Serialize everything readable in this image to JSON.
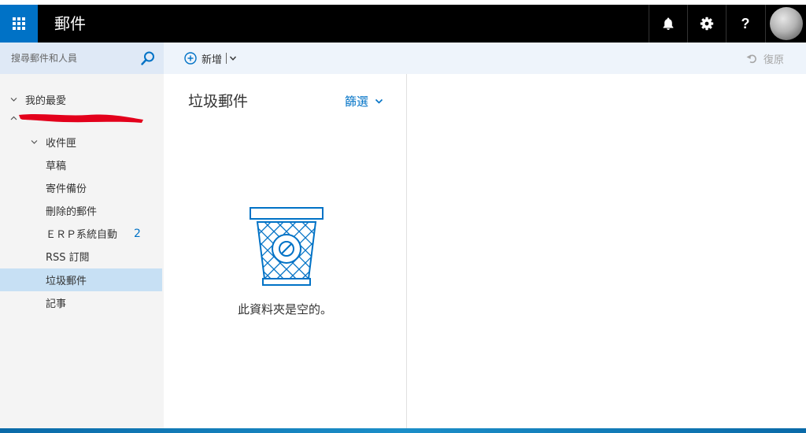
{
  "header": {
    "app_title": "郵件",
    "icons": {
      "launcher": "app-launcher-icon",
      "notifications": "bell-icon",
      "settings": "gear-icon",
      "help": "help-icon",
      "avatar": "avatar"
    },
    "help_glyph": "?"
  },
  "search": {
    "placeholder": "搜尋郵件和人員"
  },
  "toolbar": {
    "new_label": "新增",
    "undo_label": "復原"
  },
  "nav": {
    "favorites_label": "我的最愛",
    "account_label": "",
    "items": [
      {
        "label": "收件匣",
        "count": ""
      },
      {
        "label": "草稿",
        "count": ""
      },
      {
        "label": "寄件備份",
        "count": ""
      },
      {
        "label": "刪除的郵件",
        "count": ""
      },
      {
        "label": "ＥＲＰ系統自動",
        "count": "2"
      },
      {
        "label": "RSS 訂閱",
        "count": ""
      },
      {
        "label": "垃圾郵件",
        "count": ""
      },
      {
        "label": "記事",
        "count": ""
      }
    ],
    "selected_index": 6
  },
  "list": {
    "folder_title": "垃圾郵件",
    "filter_label": "篩選",
    "empty_message": "此資料夾是空的。"
  },
  "colors": {
    "brand_blue": "#0072c6",
    "top_bar": "#000000",
    "selected_row": "#c7e0f4",
    "nav_bg": "#f4f4f4",
    "redaction": "#e3001b"
  }
}
